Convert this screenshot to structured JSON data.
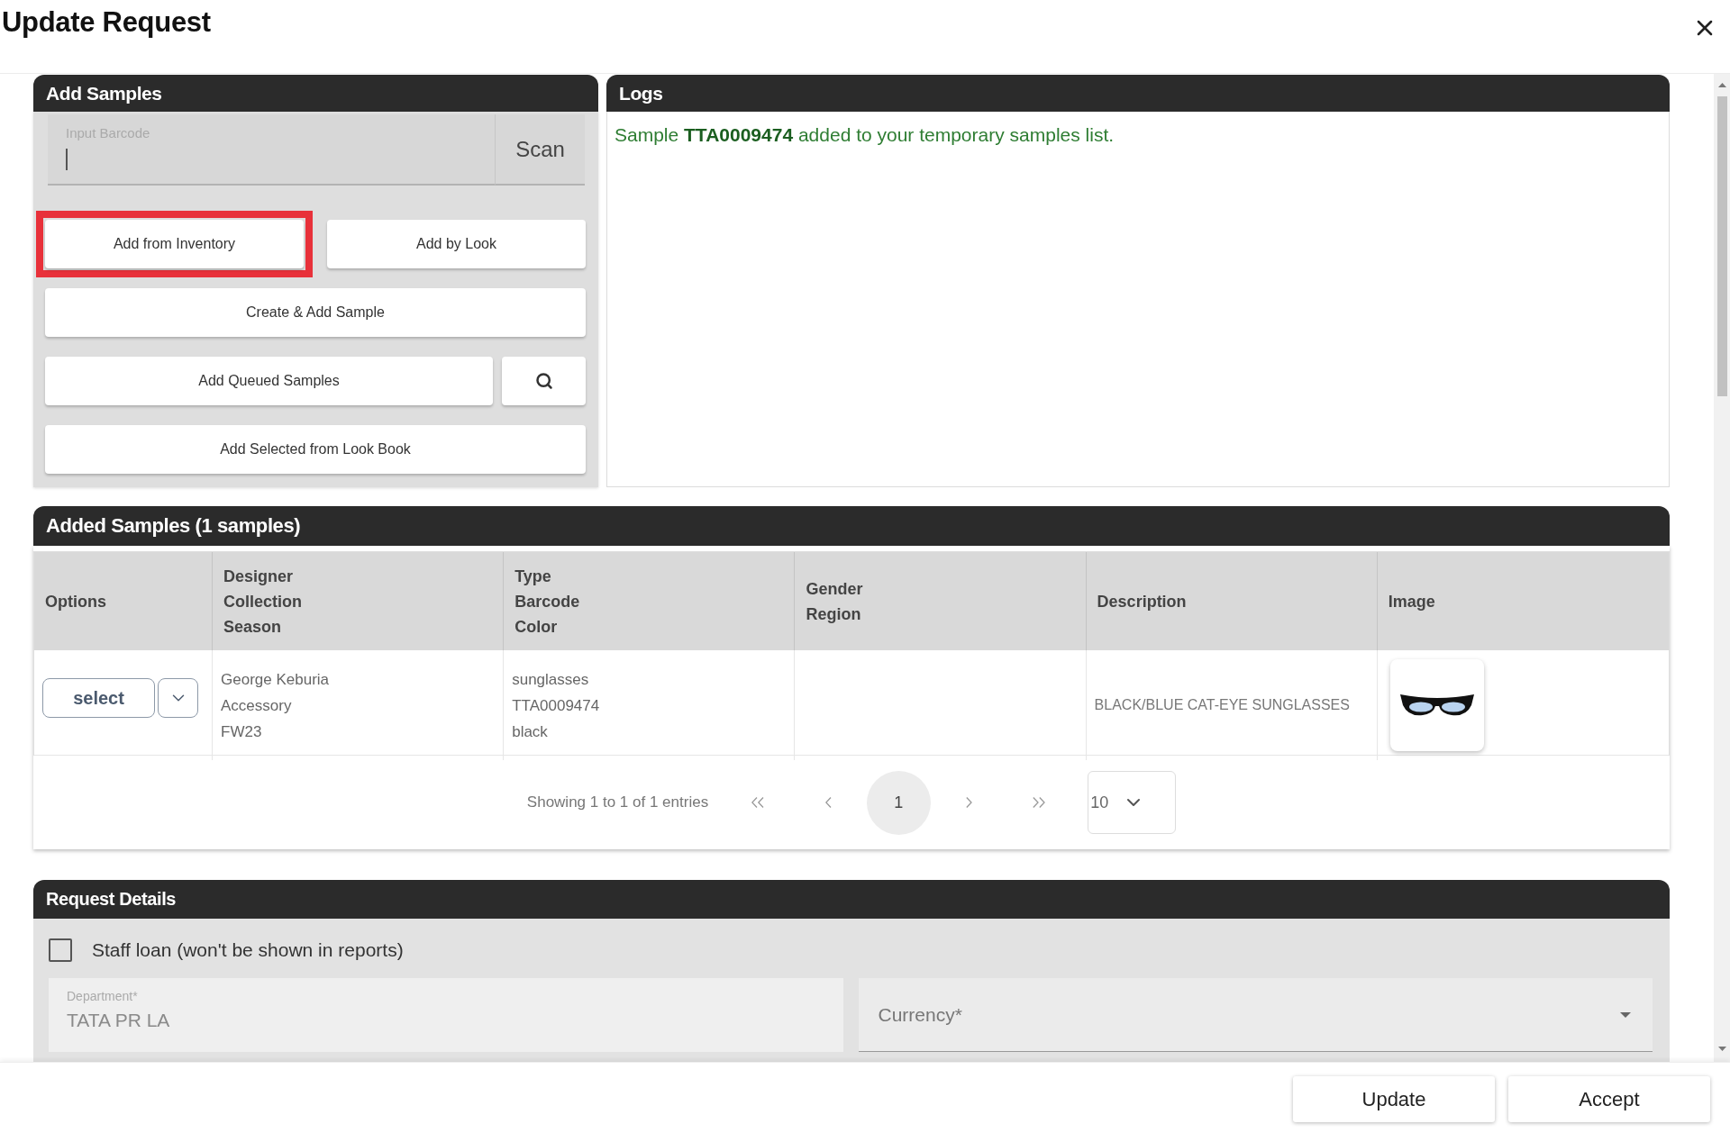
{
  "window": {
    "title": "Update Request"
  },
  "add_samples": {
    "title": "Add Samples",
    "barcode_field": {
      "label": "Input Barcode",
      "focused": true
    },
    "scan_button": "Scan",
    "button_rows": [
      [
        {
          "kind": "text",
          "label": "Add from Inventory",
          "highlighted": true
        },
        {
          "kind": "text",
          "label": "Add by Look",
          "highlighted": false
        }
      ],
      [
        {
          "kind": "text",
          "label": "Create & Add Sample",
          "highlighted": false
        }
      ],
      [
        {
          "kind": "text",
          "label": "Add Queued Samples",
          "highlighted": false
        },
        {
          "kind": "search",
          "highlighted": false
        }
      ],
      [
        {
          "kind": "text",
          "label": "Add Selected from Look Book",
          "highlighted": false
        }
      ]
    ]
  },
  "logs": {
    "title": "Logs",
    "entries": [
      "Sample **TTA0009474** added to your temporary samples list."
    ]
  },
  "added_samples": {
    "title": "Added Samples (1 samples)",
    "table": {
      "columns": [
        {
          "lines": [
            "Options"
          ]
        },
        {
          "lines": [
            "Designer",
            "Collection",
            "Season"
          ]
        },
        {
          "lines": [
            "Type",
            "Barcode",
            "Color"
          ]
        },
        {
          "lines": [
            "Gender",
            "Region"
          ]
        },
        {
          "lines": [
            "Description"
          ]
        },
        {
          "lines": [
            "Image"
          ]
        }
      ],
      "rows": [
        {
          "cells": [
            {
              "kind": "options",
              "label": "select"
            },
            {
              "kind": "lines",
              "lines": [
                "George Keburia",
                "Accessory",
                "FW23"
              ]
            },
            {
              "kind": "lines",
              "lines": [
                "sunglasses",
                "TTA0009474",
                "black"
              ]
            },
            {
              "kind": "blank"
            },
            {
              "kind": "text",
              "text": "BLACK/BLUE CAT-EYE SUNGLASSES"
            },
            {
              "kind": "image"
            }
          ]
        }
      ]
    },
    "pagination": {
      "summary": "Showing 1 to 1 of 1 entries",
      "pages": [
        {
          "label": "1",
          "selected": true
        }
      ],
      "page_size": "10"
    }
  },
  "request_details": {
    "title": "Request Details",
    "staff_loan": {
      "label": "Staff loan (won't be shown in reports)",
      "checked": false
    },
    "department": {
      "label": "Department*",
      "value": "TATA PR LA",
      "disabled": true
    },
    "currency": {
      "placeholder": "Currency*"
    }
  },
  "footer": {
    "buttons": [
      "Update",
      "Accept"
    ]
  }
}
